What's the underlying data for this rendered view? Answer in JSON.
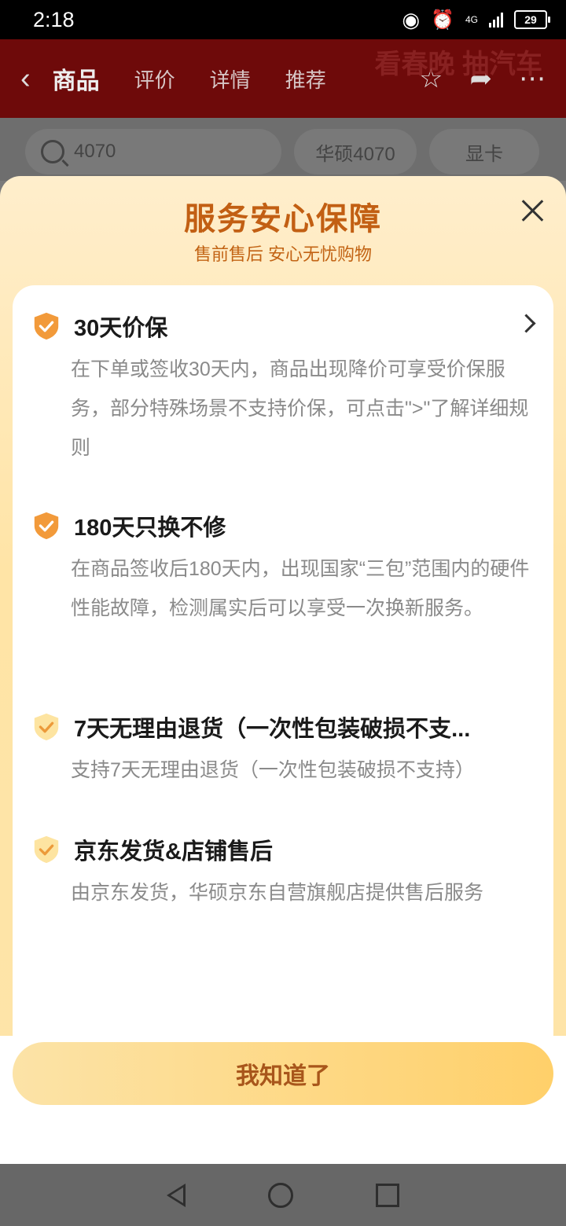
{
  "status_bar": {
    "time": "2:18",
    "network": "4G",
    "battery": "29"
  },
  "app_header": {
    "tabs": [
      {
        "label": "商品"
      },
      {
        "label": "评价"
      },
      {
        "label": "详情"
      },
      {
        "label": "推荐"
      }
    ],
    "decor_text": "看春晚 抽汽车"
  },
  "search_row": {
    "query": "4070",
    "suggestions": [
      "华硕4070",
      "显卡"
    ]
  },
  "sheet": {
    "title": "服务安心保障",
    "subtitle": "售前售后 安心无忧购物",
    "items": [
      {
        "label": "30天价保",
        "desc": "在下单或签收30天内，商品出现降价可享受价保服务，部分特殊场景不支持价保，可点击\">\"了解详细规则"
      },
      {
        "label": "180天只换不修",
        "desc": "在商品签收后180天内，出现国家“三包”范围内的硬件性能故障，检测属实后可以享受一次换新服务。"
      },
      {
        "label": "7天无理由退货（一次性包装破损不支...",
        "desc": "支持7天无理由退货（一次性包装破损不支持）"
      },
      {
        "label": "京东发货&店铺售后",
        "desc": "由京东发货，华硕京东自营旗舰店提供售后服务"
      }
    ],
    "confirm_button": "我知道了"
  },
  "colors": {
    "title": "#c25f13",
    "button_text": "#a8561b",
    "shield_orange": "#f29a3a",
    "shield_light": "#fde4a1",
    "check": "#f0a040"
  }
}
